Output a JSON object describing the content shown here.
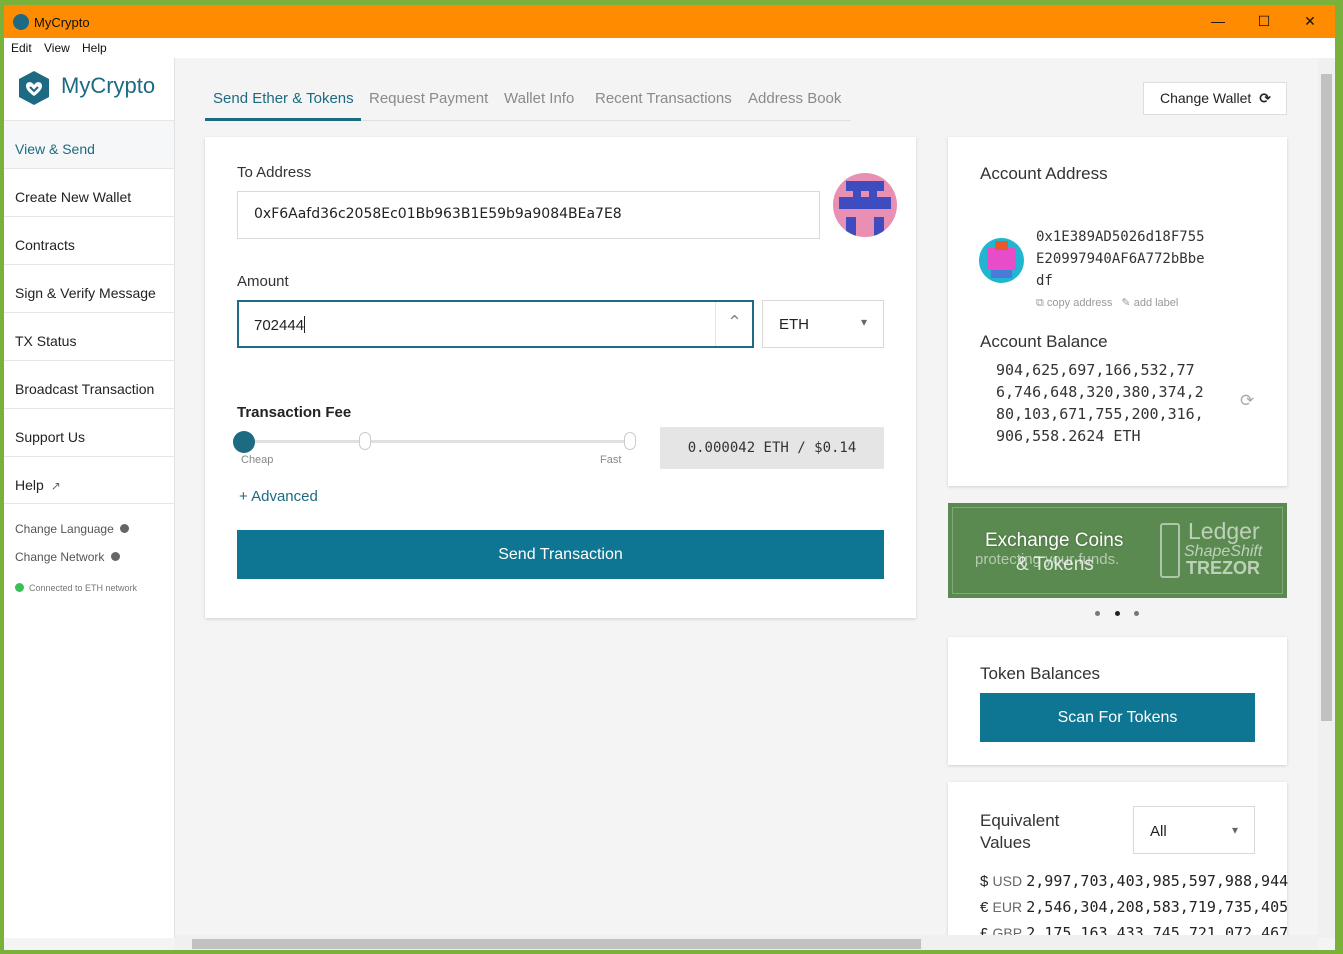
{
  "window": {
    "title": "MyCrypto",
    "minimize": "—",
    "maximize": "☐",
    "close": "✕"
  },
  "menu": [
    "Edit",
    "View",
    "Help"
  ],
  "brand": {
    "name": "MyCrypto"
  },
  "sidebar": {
    "items": [
      "View & Send",
      "Create New Wallet",
      "Contracts",
      "Sign & Verify Message",
      "TX Status",
      "Broadcast Transaction",
      "Support Us",
      "Help"
    ],
    "help_icon": "↗",
    "change_language": "Change Language",
    "change_network": "Change Network",
    "network_status": "Connected to ETH network"
  },
  "tabs": [
    "Send Ether & Tokens",
    "Request Payment",
    "Wallet Info",
    "Recent Transactions",
    "Address Book"
  ],
  "change_wallet": {
    "label": "Change Wallet",
    "icon": "⟳"
  },
  "send_form": {
    "to_label": "To Address",
    "to_value": "0xF6Aafd36c2058Ec01Bb963B1E59b9a9084BEa7E8",
    "amount_label": "Amount",
    "amount_value": "702444",
    "amount_icon": "⌃",
    "unit": "ETH",
    "unit_caret": "▾",
    "fee_label": "Transaction Fee",
    "fee_cheap": "Cheap",
    "fee_fast": "Fast",
    "fee_value": "0.000042 ETH / $0.14",
    "advanced": "+ Advanced",
    "send_button": "Send Transaction"
  },
  "account": {
    "title": "Account Address",
    "address_lines": [
      "0x1E389AD5026d18F755",
      "E20997940AF6A772bBbe",
      "df"
    ],
    "copy_address": "copy address",
    "add_label": "add label",
    "balance_title": "Account Balance",
    "balance_lines": [
      "904,625,697,166,532,77",
      "6,746,648,320,380,374,2",
      "80,103,671,755,200,316,",
      "906,558.2624  ETH"
    ],
    "refresh_icon": "⟳"
  },
  "banner": {
    "text_a": "Exchange Coins",
    "text_b": "protecting your funds.",
    "text_c": "& Tokens",
    "brand_ledger": "Ledger",
    "brand_shapeshift": "ShapeShift",
    "brand_trezor": "TREZOR"
  },
  "token_balances": {
    "title": "Token Balances",
    "button": "Scan For Tokens"
  },
  "equivalent": {
    "title_line1": "Equivalent",
    "title_line2": "Values",
    "select_value": "All",
    "rows": [
      {
        "symbol": "$",
        "code": "USD",
        "value": "2,997,703,403,985,597,988,944"
      },
      {
        "symbol": "€",
        "code": "EUR",
        "value": "2,546,304,208,583,719,735,405"
      },
      {
        "symbol": "£",
        "code": "GBP",
        "value": "2,175,163,433,745,721,072,467"
      }
    ]
  },
  "colors": {
    "accent": "#1c6b82",
    "button": "#0e7592",
    "titlebar": "#ff8c00",
    "status_green": "#3cbe58"
  }
}
